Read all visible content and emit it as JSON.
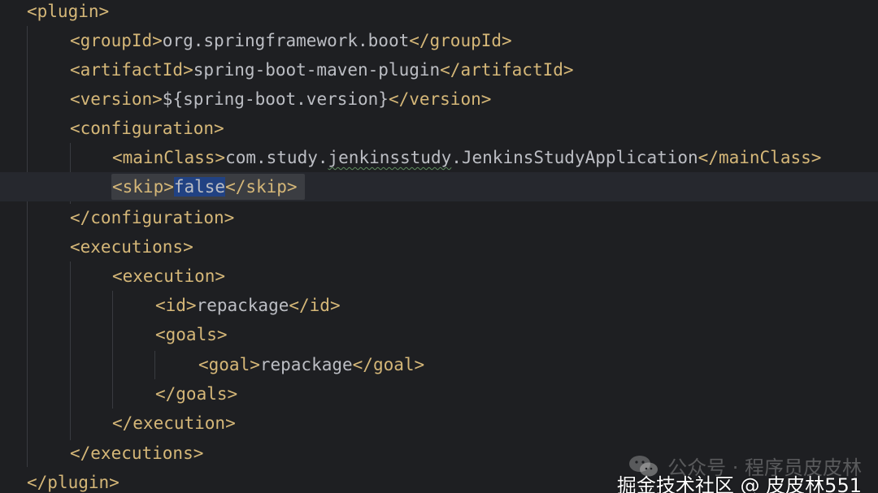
{
  "lines": [
    {
      "parts": [
        {
          "t": "<plugin",
          "c": "tag"
        },
        {
          "t": ">",
          "c": "tag"
        }
      ]
    },
    {
      "parts": [
        {
          "t": "<groupId>",
          "c": "tag"
        },
        {
          "t": "org.springframework.boot",
          "c": "txt"
        },
        {
          "t": "</groupId>",
          "c": "tag"
        }
      ]
    },
    {
      "parts": [
        {
          "t": "<artifactId>",
          "c": "tag"
        },
        {
          "t": "spring-boot-maven-plugin",
          "c": "txt"
        },
        {
          "t": "</artifactId>",
          "c": "tag"
        }
      ]
    },
    {
      "parts": [
        {
          "t": "<version>",
          "c": "tag"
        },
        {
          "t": "${spring-boot.version}",
          "c": "txt"
        },
        {
          "t": "</version>",
          "c": "tag"
        }
      ]
    },
    {
      "parts": [
        {
          "t": "<configuration>",
          "c": "tag"
        }
      ]
    },
    {
      "parts": [
        {
          "t": "<mainClass>",
          "c": "tag"
        },
        {
          "t": "com.study.",
          "c": "txt"
        },
        {
          "t": "jenkinsstudy",
          "c": "txt wavy"
        },
        {
          "t": ".JenkinsStudyApplication",
          "c": "txt"
        },
        {
          "t": "</mainClass>",
          "c": "tag"
        }
      ]
    },
    {
      "parts": [
        {
          "t": "<skip>",
          "c": "tag"
        },
        {
          "t": "false",
          "c": "txt sel"
        },
        {
          "t": "</skip>",
          "c": "tag"
        }
      ]
    },
    {
      "parts": [
        {
          "t": "</configuration>",
          "c": "tag"
        }
      ]
    },
    {
      "parts": [
        {
          "t": "<executions>",
          "c": "tag"
        }
      ]
    },
    {
      "parts": [
        {
          "t": "<execution>",
          "c": "tag"
        }
      ]
    },
    {
      "parts": [
        {
          "t": "<id>",
          "c": "tag"
        },
        {
          "t": "repackage",
          "c": "txt"
        },
        {
          "t": "</id>",
          "c": "tag"
        }
      ]
    },
    {
      "parts": [
        {
          "t": "<goals>",
          "c": "tag"
        }
      ]
    },
    {
      "parts": [
        {
          "t": "<goal>",
          "c": "tag"
        },
        {
          "t": "repackage",
          "c": "txt"
        },
        {
          "t": "</goal>",
          "c": "tag"
        }
      ]
    },
    {
      "parts": [
        {
          "t": "</goals>",
          "c": "tag"
        }
      ]
    },
    {
      "parts": [
        {
          "t": "</execution>",
          "c": "tag"
        }
      ]
    },
    {
      "parts": [
        {
          "t": "</executions>",
          "c": "tag"
        }
      ]
    },
    {
      "parts": [
        {
          "t": "</plugin>",
          "c": "tag"
        }
      ]
    }
  ],
  "watermark": {
    "account": "公众号 · 程序员皮皮林",
    "community": "掘金技术社区 @ 皮皮林551"
  },
  "colors": {
    "background": "#1e1f22",
    "tag": "#d5b778",
    "text": "#bcbec4",
    "selection": "#214283",
    "current_line": "#26282e"
  }
}
